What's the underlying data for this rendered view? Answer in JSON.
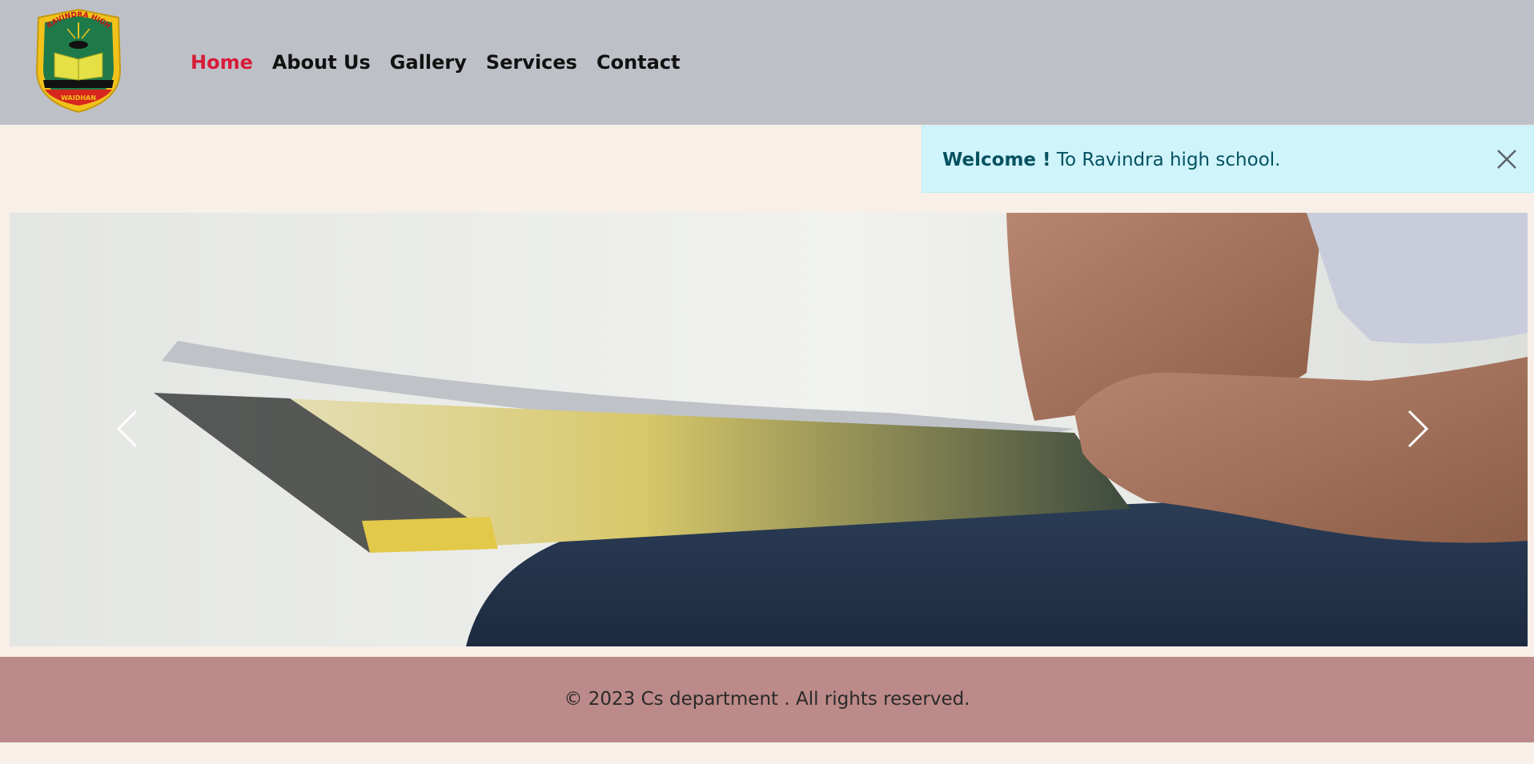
{
  "header": {
    "logo_text": "RAVINDRA HIGH SCHOOL",
    "logo_sub": "WAIDHAN",
    "nav": [
      {
        "label": "Home",
        "active": true
      },
      {
        "label": "About Us",
        "active": false
      },
      {
        "label": "Gallery",
        "active": false
      },
      {
        "label": "Services",
        "active": false
      },
      {
        "label": "Contact",
        "active": false
      }
    ],
    "active_color": "#d81b3a"
  },
  "alert": {
    "strong": "Welcome !",
    "text": " To Ravindra high school.",
    "close_icon": "close-icon"
  },
  "carousel": {
    "image": "person-reading-magazine",
    "prev_icon": "chevron-left-icon",
    "next_icon": "chevron-right-icon"
  },
  "footer": {
    "copyright": "© 2023 Cs department . All rights reserved."
  },
  "colors": {
    "header_bg": "#bec0c8",
    "page_bg": "#f7efe8",
    "alert_bg": "#cff4fc",
    "alert_text": "#055160",
    "footer_bg": "#bc8a89"
  }
}
